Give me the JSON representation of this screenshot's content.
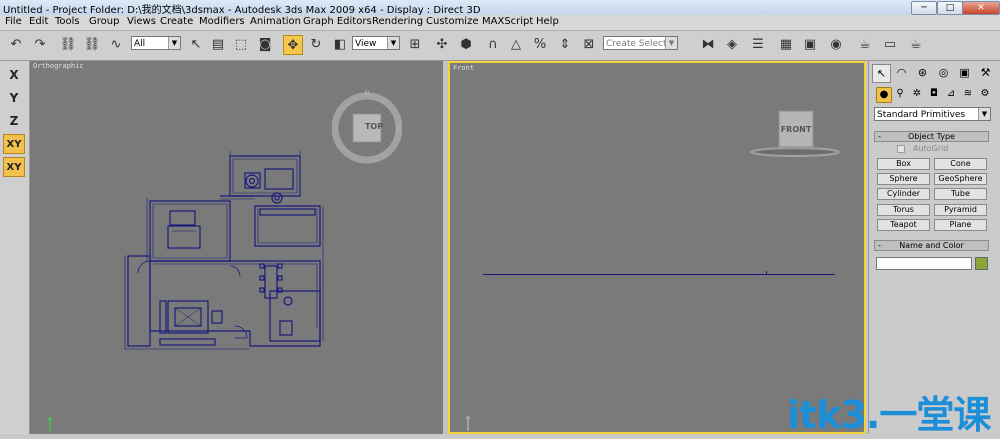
{
  "title_bar": {
    "text": "Untitled      - Project Folder: D:\\我的文档\\3dsmax      - Autodesk 3ds Max  2009 x64      - Display : Direct 3D",
    "minimize": "─",
    "maximize": "□",
    "close": "✕"
  },
  "menu": [
    "File",
    "Edit",
    "Tools",
    "Group",
    "Views",
    "Create",
    "Modifiers",
    "Animation",
    "Graph Editors",
    "Rendering",
    "Customize",
    "MAXScript",
    "Help"
  ],
  "toolbar": {
    "selection_filter": "All",
    "reference_coord": "View",
    "named_selection_placeholder": "Create Selection Set"
  },
  "axis_constraints": [
    "X",
    "Y",
    "Z",
    "XY",
    "XY"
  ],
  "viewports": {
    "ortho": {
      "label": "Orthographic",
      "viewcube_face": "TOP"
    },
    "front": {
      "label": "Front",
      "viewcube_face": "FRONT"
    }
  },
  "command_panel": {
    "category_dropdown": "Standard Primitives",
    "object_type": {
      "header": "Object Type",
      "autogrid_label": "AutoGrid",
      "buttons": [
        "Box",
        "Cone",
        "Sphere",
        "GeoSphere",
        "Cylinder",
        "Tube",
        "Torus",
        "Pyramid",
        "Teapot",
        "Plane"
      ]
    },
    "name_and_color": {
      "header": "Name and Color",
      "name_value": "",
      "color": "#8aa63a"
    },
    "rollout_toggle": "-"
  },
  "watermark": "itk3.一堂课",
  "colors": {
    "active_viewport_border": "#f2d33c",
    "viewport_bg": "#7a7a7a",
    "floorplan_lines": "#1a1a7a"
  }
}
